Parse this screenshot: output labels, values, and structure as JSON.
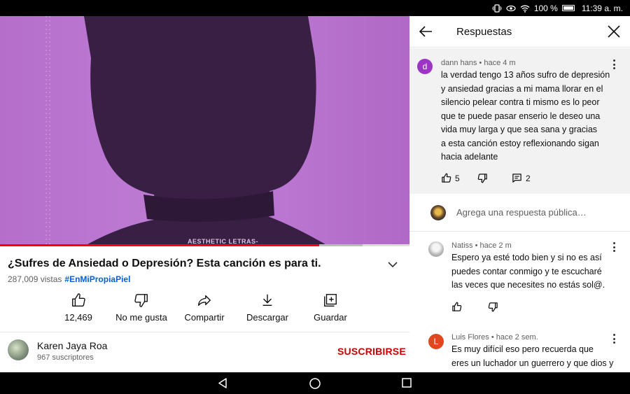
{
  "status_bar": {
    "battery": "100 %",
    "time": "11:39 a. m."
  },
  "video": {
    "watermark": "AESTHETIC LETRAS-",
    "progress_fraction": 0.78,
    "buffer_fraction": 0.885
  },
  "video_info": {
    "title": "¿Sufres de Ansiedad o Depresión? Esta canción es para ti.",
    "views": "287,009 vistas",
    "hashtag": "#EnMiPropiaPiel"
  },
  "actions": {
    "like_count": "12,469",
    "dislike_label": "No me gusta",
    "share_label": "Compartir",
    "download_label": "Descargar",
    "save_label": "Guardar"
  },
  "channel": {
    "name": "Karen Jaya Roa",
    "subscribers": "967 suscriptores",
    "subscribe_label": "SUSCRIBIRSE"
  },
  "panel": {
    "title": "Respuestas",
    "parent_comment": {
      "avatar_letter": "d",
      "avatar_color": "#9c35c6",
      "author_line": "dann hans • hace 4 m",
      "text": "la verdad tengo 13 años sufro de depresión\ny ansiedad gracias a mi mama llorar en el\nsilencio pelear contra ti mismo es lo peor\nque te  puede pasar enserio le deseo una\nvida muy larga y que sea sana y gracias\na esta canción estoy reflexionando sigan\nhacia adelante",
      "likes": "5",
      "replies": "2"
    },
    "reply_placeholder": "Agrega una respuesta pública…",
    "replies": [
      {
        "author_line": "Natiss • hace 2 m",
        "text": "Espero ya esté todo bien y si no es así\npuedes contar conmigo y te escucharé\nlas veces que necesites no estás sol@."
      },
      {
        "avatar_letter": "L",
        "avatar_color": "#e0471f",
        "author_line": "Luis Flores • hace 2 sem.",
        "text": "Es muy difícil eso  pero recuerda que\neres un luchador un guerrero y que dios y"
      }
    ]
  }
}
